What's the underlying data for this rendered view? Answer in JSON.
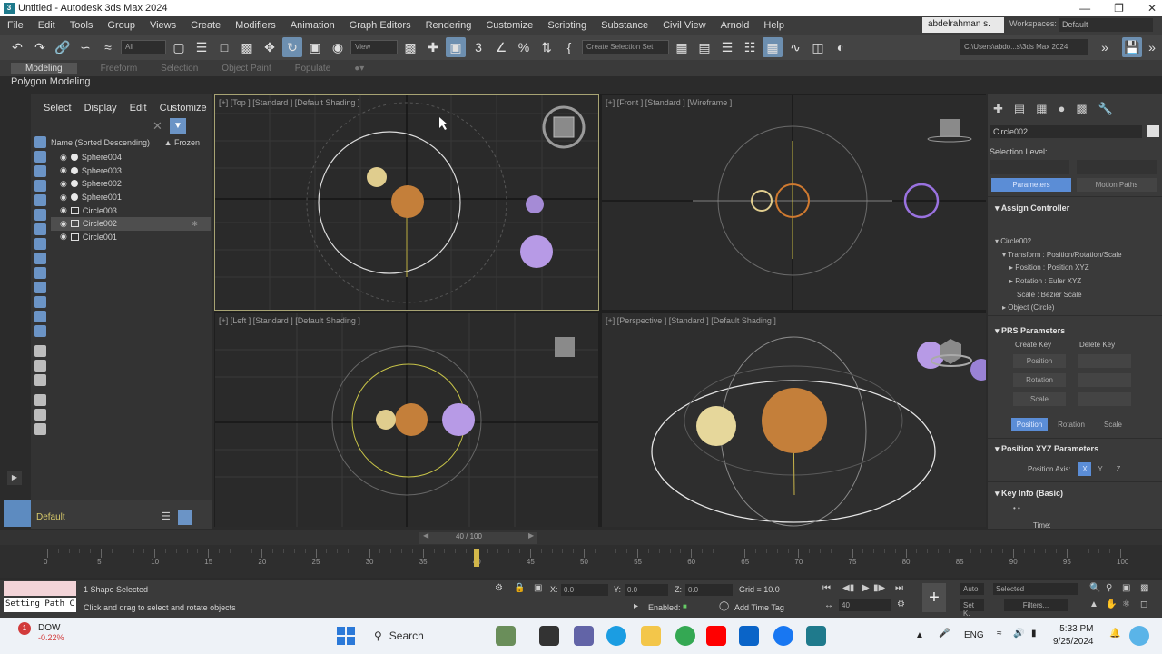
{
  "window": {
    "title": "Untitled - Autodesk 3ds Max 2024",
    "app_icon": "3ds-max-icon"
  },
  "menu": {
    "items": [
      "File",
      "Edit",
      "Tools",
      "Group",
      "Views",
      "Create",
      "Modifiers",
      "Animation",
      "Graph Editors",
      "Rendering",
      "Customize",
      "Scripting",
      "Substance",
      "Civil View",
      "Arnold",
      "Help"
    ],
    "user": "abdelrahman s.",
    "workspace_label": "Workspaces:",
    "workspace_value": "Default"
  },
  "toolbar": {
    "selection_filter": "All",
    "ref_coord": "View",
    "named_selection": "Create Selection Set",
    "project_path": "C:\\Users\\abdo...s\\3ds Max 2024"
  },
  "ribbon": {
    "tabs": [
      "Modeling",
      "Freeform",
      "Selection",
      "Object Paint",
      "Populate"
    ],
    "active": "Modeling",
    "subtitle": "Polygon Modeling"
  },
  "explorer": {
    "menu": [
      "Select",
      "Display",
      "Edit",
      "Customize"
    ],
    "column_name": "Name (Sorted Descending)",
    "column_frozen": "▲ Frozen",
    "rows": [
      {
        "name": "Sphere004",
        "kind": "sphere",
        "selected": false
      },
      {
        "name": "Sphere003",
        "kind": "sphere",
        "selected": false
      },
      {
        "name": "Sphere002",
        "kind": "sphere",
        "selected": false
      },
      {
        "name": "Sphere001",
        "kind": "sphere",
        "selected": false
      },
      {
        "name": "Circle003",
        "kind": "shape",
        "selected": false
      },
      {
        "name": "Circle002",
        "kind": "shape",
        "selected": true
      },
      {
        "name": "Circle001",
        "kind": "shape",
        "selected": false
      }
    ],
    "layer": "Default"
  },
  "viewports": {
    "top": "[+] [Top ] [Standard ] [Default Shading ]",
    "front": "[+] [Front ] [Standard ] [Wireframe ]",
    "left": "[+] [Left ] [Standard ] [Default Shading ]",
    "perspective": "[+] [Perspective ] [Standard ] [Default Shading ]"
  },
  "command_panel": {
    "object_name": "Circle002",
    "selection_level_label": "Selection Level:",
    "sub_buttons": [
      "Parameters",
      "Motion Paths"
    ],
    "assign_controller": "Assign Controller",
    "controller_tree": [
      "Circle002",
      "Transform : Position/Rotation/Scale",
      "Position : Position XYZ",
      "Rotation : Euler XYZ",
      "Scale : Bezier Scale",
      "Object (Circle)"
    ],
    "prs_title": "PRS Parameters",
    "create_key": "Create Key",
    "delete_key": "Delete Key",
    "prs_buttons": [
      "Position",
      "Rotation",
      "Scale"
    ],
    "prs_tabs": [
      "Position",
      "Rotation",
      "Scale"
    ],
    "pos_xyz_title": "Position XYZ Parameters",
    "position_axis_label": "Position Axis:",
    "axes": [
      "X",
      "Y",
      "Z"
    ],
    "key_info": "Key Info (Basic)",
    "time_label": "Time:"
  },
  "timeline": {
    "frame_display": "40 / 100",
    "current_frame": 40,
    "ticks": [
      "0",
      "5",
      "10",
      "15",
      "20",
      "25",
      "30",
      "35",
      "40",
      "45",
      "50",
      "55",
      "60",
      "65",
      "70",
      "75",
      "80",
      "85",
      "90",
      "95",
      "100"
    ]
  },
  "status": {
    "maxscript": "Setting Path C",
    "selected": "1 Shape Selected",
    "prompt": "Click and drag to select and rotate objects",
    "x_label": "X:",
    "x_value": "0.0",
    "y_label": "Y:",
    "y_value": "0.0",
    "z_label": "Z:",
    "z_value": "0.0",
    "grid": "Grid = 10.0",
    "enabled_label": "Enabled:",
    "add_time_tag": "Add Time Tag",
    "frame_field": "40",
    "auto": "Auto",
    "set_k": "Set K.",
    "selected_dropdown": "Selected",
    "filters": "Filters..."
  },
  "taskbar": {
    "weather_title": "DOW",
    "weather_change": "-0.22%",
    "badge": "1",
    "search": "Search",
    "lang": "ENG",
    "time": "5:33 PM",
    "date": "9/25/2024"
  }
}
